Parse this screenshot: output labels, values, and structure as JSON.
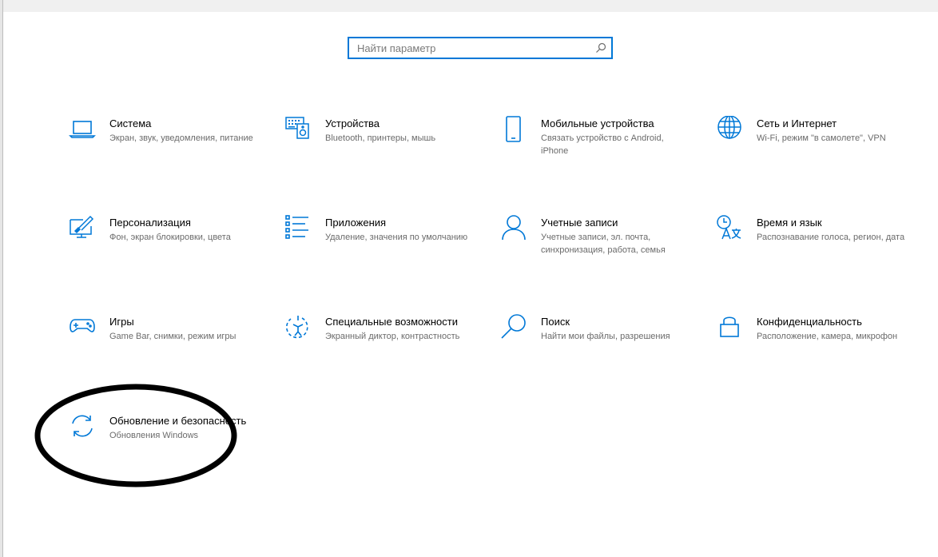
{
  "search": {
    "placeholder": "Найти параметр"
  },
  "accent_color": "#0078d7",
  "tiles": [
    {
      "id": "system",
      "icon": "laptop-icon",
      "title": "Система",
      "desc": "Экран, звук, уведомления, питание"
    },
    {
      "id": "devices",
      "icon": "keyboard-speaker-icon",
      "title": "Устройства",
      "desc": "Bluetooth, принтеры, мышь"
    },
    {
      "id": "phone",
      "icon": "phone-icon",
      "title": "Мобильные устройства",
      "desc": "Связать устройство с Android, iPhone"
    },
    {
      "id": "network",
      "icon": "globe-icon",
      "title": "Сеть и Интернет",
      "desc": "Wi-Fi, режим \"в самолете\", VPN"
    },
    {
      "id": "personalization",
      "icon": "paint-brush-icon",
      "title": "Персонализация",
      "desc": "Фон, экран блокировки, цвета"
    },
    {
      "id": "apps",
      "icon": "app-list-icon",
      "title": "Приложения",
      "desc": "Удаление, значения по умолчанию"
    },
    {
      "id": "accounts",
      "icon": "person-icon",
      "title": "Учетные записи",
      "desc": "Учетные записи, эл. почта, синхронизация, работа, семья"
    },
    {
      "id": "time",
      "icon": "clock-language-icon",
      "title": "Время и язык",
      "desc": "Распознавание голоса, регион, дата"
    },
    {
      "id": "gaming",
      "icon": "gamepad-icon",
      "title": "Игры",
      "desc": "Game Bar, снимки, режим игры"
    },
    {
      "id": "accessibility",
      "icon": "ease-of-access-icon",
      "title": "Специальные возможности",
      "desc": "Экранный диктор, контрастность"
    },
    {
      "id": "search",
      "icon": "magnifier-icon",
      "title": "Поиск",
      "desc": "Найти мои файлы, разрешения"
    },
    {
      "id": "privacy",
      "icon": "lock-icon",
      "title": "Конфиденциальность",
      "desc": "Расположение, камера, микрофон"
    },
    {
      "id": "update",
      "icon": "refresh-icon",
      "title": "Обновление и безопасность",
      "desc": "Обновления Windows"
    }
  ]
}
